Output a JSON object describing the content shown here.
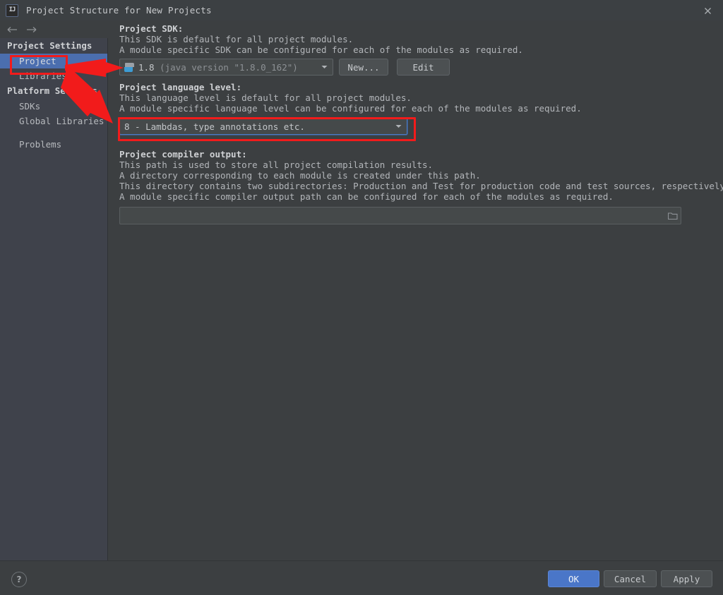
{
  "window": {
    "title": "Project Structure for New Projects",
    "app_icon": "intellij-idea-icon",
    "close_label": "✕"
  },
  "nav": {
    "back_label": "←",
    "forward_label": "→"
  },
  "sidebar": {
    "groups": [
      {
        "label": "Project Settings",
        "items": [
          {
            "label": "Project",
            "selected": true
          },
          {
            "label": "Libraries",
            "selected": false
          }
        ]
      },
      {
        "label": "Platform Settings",
        "items": [
          {
            "label": "SDKs",
            "selected": false
          },
          {
            "label": "Global Libraries",
            "selected": false
          }
        ]
      }
    ],
    "extra_items": [
      {
        "label": "Problems",
        "selected": false
      }
    ]
  },
  "main": {
    "sdk": {
      "title": "Project SDK:",
      "desc": [
        "This SDK is default for all project modules.",
        "A module specific SDK can be configured for each of the modules as required."
      ],
      "combo_icon": "java-sdk-icon",
      "value": "1.8",
      "value_detail": "(java version \"1.8.0_162\")",
      "dropdown_arrow": "chevron-down-icon",
      "new_button": "New...",
      "edit_button": "Edit"
    },
    "language_level": {
      "title": "Project language level:",
      "desc": [
        "This language level is default for all project modules.",
        "A module specific language level can be configured for each of the modules as required."
      ],
      "value": "8 - Lambdas, type annotations etc.",
      "dropdown_arrow": "chevron-down-icon",
      "focused": true
    },
    "compiler_output": {
      "title": "Project compiler output:",
      "desc": [
        "This path is used to store all project compilation results.",
        "A directory corresponding to each module is created under this path.",
        "This directory contains two subdirectories: Production and Test for production code and test sources, respectively.",
        "A module specific compiler output path can be configured for each of the modules as required."
      ],
      "value": "",
      "placeholder": "",
      "browse_icon": "folder-browse-icon"
    }
  },
  "footer": {
    "help_label": "?",
    "ok_label": "OK",
    "cancel_label": "Cancel",
    "apply_label": "Apply"
  },
  "annotations": {
    "highlight_color": "#f21b1b",
    "boxes": [
      {
        "name": "project-item-highlight"
      },
      {
        "name": "language-level-highlight"
      }
    ],
    "arrows": [
      {
        "name": "arrow-to-sdk-combo"
      },
      {
        "name": "arrow-to-language-level-combo"
      }
    ]
  },
  "colors": {
    "background": "#3c3f41",
    "sidebar": "#3f424b",
    "selection": "#4b6eaf",
    "primary_button": "#4a76c8",
    "accent_focus": "#4d7bc4"
  }
}
